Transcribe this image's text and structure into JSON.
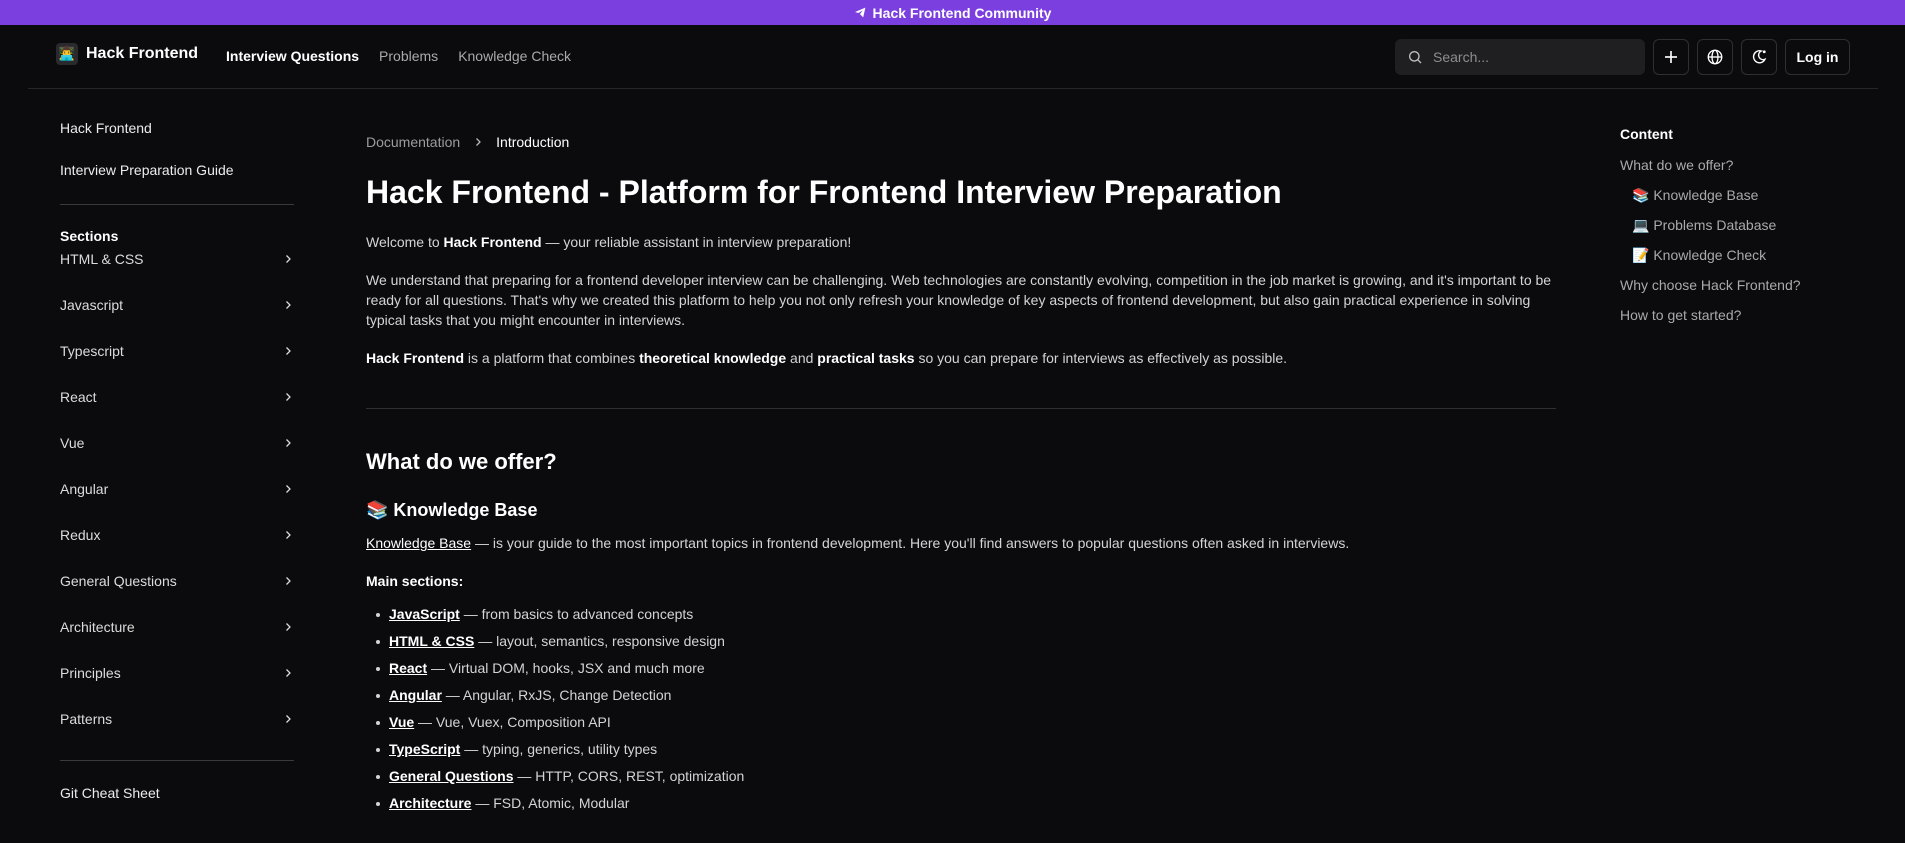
{
  "banner": {
    "text": "Hack Frontend Community",
    "icon": "telegram-icon"
  },
  "header": {
    "brand": "Hack Frontend",
    "brand_emoji": "👨‍💻",
    "nav": [
      {
        "label": "Interview Questions",
        "active": true
      },
      {
        "label": "Problems",
        "active": false
      },
      {
        "label": "Knowledge Check",
        "active": false
      }
    ],
    "search_placeholder": "Search...",
    "login_label": "Log in"
  },
  "sidebar": {
    "top_links": [
      "Hack Frontend",
      "Interview Preparation Guide"
    ],
    "sections_heading": "Sections",
    "sections": [
      "HTML & CSS",
      "Javascript",
      "Typescript",
      "React",
      "Vue",
      "Angular",
      "Redux",
      "General Questions",
      "Architecture",
      "Principles",
      "Patterns"
    ],
    "bottom_link": "Git Cheat Sheet"
  },
  "main": {
    "breadcrumb": [
      "Documentation",
      "Introduction"
    ],
    "title": "Hack Frontend - Platform for Frontend Interview Preparation",
    "welcome": {
      "pre": "Welcome to ",
      "bold": "Hack Frontend",
      "post": " — your reliable assistant in interview preparation!"
    },
    "intro": "We understand that preparing for a frontend developer interview can be challenging. Web technologies are constantly evolving, competition in the job market is growing, and it's important to be ready for all questions. That's why we created this platform to help you not only refresh your knowledge of key aspects of frontend development, but also gain practical experience in solving typical tasks that you might encounter in interviews.",
    "combine": {
      "b1": "Hack Frontend",
      "t1": " is a platform that combines ",
      "b2": "theoretical knowledge",
      "t2": " and ",
      "b3": "practical tasks",
      "t3": " so you can prepare for interviews as effectively as possible."
    },
    "offer_heading": "What do we offer?",
    "kb_heading": "📚 Knowledge Base",
    "kb_link": "Knowledge Base",
    "kb_text": " — is your guide to the most important topics in frontend development. Here you'll find answers to popular questions often asked in interviews.",
    "main_sections_label": "Main sections:",
    "main_sections": [
      {
        "link": "JavaScript",
        "desc": " — from basics to advanced concepts"
      },
      {
        "link": "HTML & CSS",
        "desc": " — layout, semantics, responsive design"
      },
      {
        "link": "React",
        "desc": " — Virtual DOM, hooks, JSX and much more"
      },
      {
        "link": "Angular",
        "desc": " — Angular, RxJS, Change Detection"
      },
      {
        "link": "Vue",
        "desc": " — Vue, Vuex, Composition API"
      },
      {
        "link": "TypeScript",
        "desc": " — typing, generics, utility types"
      },
      {
        "link": "General Questions",
        "desc": " — HTTP, CORS, REST, optimization"
      },
      {
        "link": "Architecture",
        "desc": " — FSD, Atomic, Modular"
      }
    ]
  },
  "toc": {
    "title": "Content",
    "items": [
      {
        "label": "What do we offer?",
        "sub": false
      },
      {
        "label": "📚 Knowledge Base",
        "sub": true
      },
      {
        "label": "💻 Problems Database",
        "sub": true
      },
      {
        "label": "📝 Knowledge Check",
        "sub": true
      },
      {
        "label": "Why choose Hack Frontend?",
        "sub": false
      },
      {
        "label": "How to get started?",
        "sub": false
      }
    ]
  }
}
